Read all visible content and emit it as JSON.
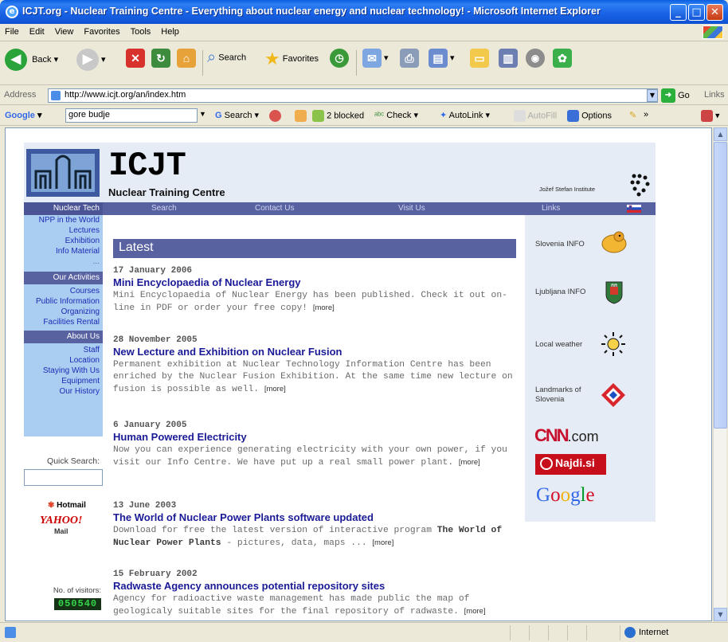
{
  "window": {
    "title": "ICJT.org - Nuclear Training Centre - Everything about nuclear energy and nuclear technology! - Microsoft Internet Explorer"
  },
  "menu": [
    "File",
    "Edit",
    "View",
    "Favorites",
    "Tools",
    "Help"
  ],
  "toolbar": {
    "back": "Back",
    "search": "Search",
    "favorites": "Favorites"
  },
  "address": {
    "label": "Address",
    "url": "http://www.icjt.org/an/index.htm",
    "go": "Go",
    "links": "Links"
  },
  "google_bar": {
    "brand": "Google",
    "query": "gore budje",
    "search": "Search",
    "blocked": "2 blocked",
    "check": "Check",
    "autolink": "AutoLink",
    "autofill": "AutoFill",
    "options": "Options"
  },
  "site": {
    "name": "ICJT",
    "subtitle": "Nuclear Training Centre",
    "institute": "Jožef Stefan Institute"
  },
  "nav": {
    "section": "Nuclear Tech",
    "items": [
      "Search",
      "Contact Us",
      "Visit Us",
      "Links"
    ]
  },
  "left_nav": {
    "group1": [
      "NPP in the World",
      "Lectures",
      "Exhibition",
      "Info Material",
      "..."
    ],
    "activities_header": "Our Activities",
    "group2": [
      "Courses",
      "Public Information",
      "Organizing",
      "Facilities Rental"
    ],
    "about_header": "About Us",
    "group3": [
      "Staff",
      "Location",
      "Staying With Us",
      "Equipment",
      "Our History"
    ],
    "quick_search": "Quick Search:",
    "hotmail": "Hotmail",
    "yahoo": "YAHOO!",
    "yahoo_mail": "Mail",
    "visitors_label": "No. of visitors:",
    "visitors_count": "050540"
  },
  "latest": {
    "heading": "Latest",
    "more": "[more]",
    "items": [
      {
        "date": "17 January 2006",
        "title": "Mini Encyclopaedia of Nuclear Energy",
        "body": "Mini Encyclopaedia of Nuclear Energy has been published. Check it out on-line in PDF or order your free copy!"
      },
      {
        "date": "28 November 2005",
        "title": "New Lecture and Exhibition on Nuclear Fusion",
        "body": "Permanent exhibition at Nuclear Technology Information Centre has been enriched by the Nuclear Fusion Exhibition. At the same time new lecture on fusion is possible as well."
      },
      {
        "date": "6 January 2005",
        "title": "Human Powered Electricity",
        "body": "Now you can experience generating electricity with your own power, if you visit our Info Centre. We have put up a real small power plant."
      },
      {
        "date": "13 June 2003",
        "title": "The World of Nuclear Power Plants software updated",
        "body_before": "Download for free the latest version of interactive program ",
        "body_em": "The World of Nuclear Power Plants",
        "body_after": " - pictures, data, maps ..."
      },
      {
        "date": "15 February 2002",
        "title": "Radwaste Agency announces potential repository sites",
        "body": "Agency for radioactive waste management has made public the map of geologicaly suitable sites for the final repository of radwaste."
      }
    ]
  },
  "right_col": {
    "slovenia": "Slovenia INFO",
    "ljubljana": "Ljubljana INFO",
    "weather": "Local weather",
    "landmarks": "Landmarks of Slovenia",
    "cnn": "CNN",
    "cnn_suffix": ".com",
    "najdi": "Najdi.si",
    "google": "Google"
  },
  "status": {
    "zone": "Internet"
  }
}
